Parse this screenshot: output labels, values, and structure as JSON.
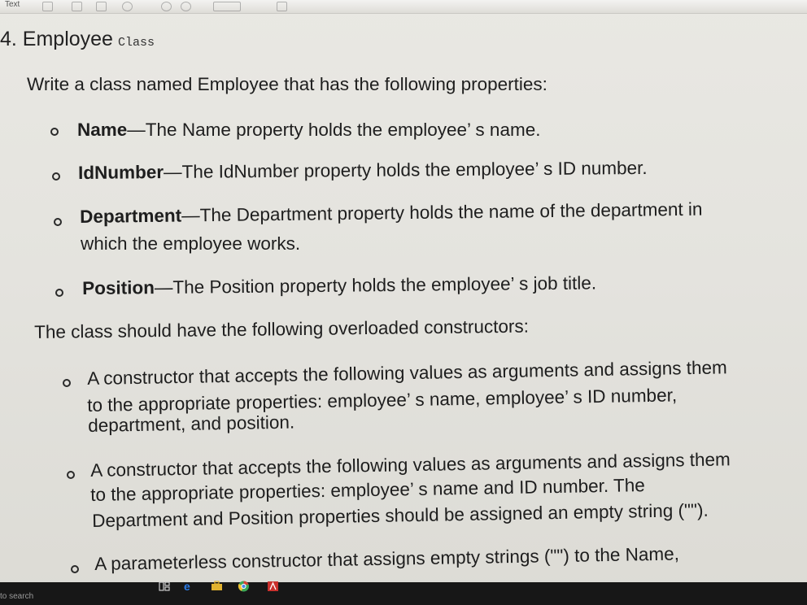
{
  "topbar": {
    "label": "Text"
  },
  "heading": {
    "number_title": "4. Employee",
    "class_word": "Class"
  },
  "intro": "Write a class named Employee that has the following properties:",
  "properties": [
    {
      "name": "Name",
      "desc": "—The Name property holds the employee’ s name."
    },
    {
      "name": "IdNumber",
      "desc": "—The IdNumber property holds the employee’ s ID number."
    },
    {
      "name": "Department",
      "desc": "—The Department property holds the name of the department in",
      "desc2": "which the employee works."
    },
    {
      "name": "Position",
      "desc": "—The Position property holds the employee’ s job title."
    }
  ],
  "constructors_intro": "The class should have the following overloaded constructors:",
  "constructors": [
    {
      "lines": [
        "A constructor that accepts the following values as arguments and assigns them",
        "to the appropriate properties: employee’ s name, employee’ s ID number,",
        "department, and position."
      ]
    },
    {
      "lines": [
        "A constructor that accepts the following values as arguments and assigns them",
        "to the appropriate properties: employee’ s name and ID number. The",
        "Department and Position properties should be assigned an empty string (\"\")."
      ]
    },
    {
      "lines": [
        "A parameterless constructor that assigns empty strings (\"\") to the Name,"
      ]
    }
  ],
  "taskbar": {
    "search_text": "to search"
  },
  "colors": {
    "taskbar": "#171717",
    "edge_blue": "#2b7de9",
    "store_yellow": "#e2b32f",
    "chrome_green": "#3aa757",
    "acrobat_red": "#c9302c"
  }
}
